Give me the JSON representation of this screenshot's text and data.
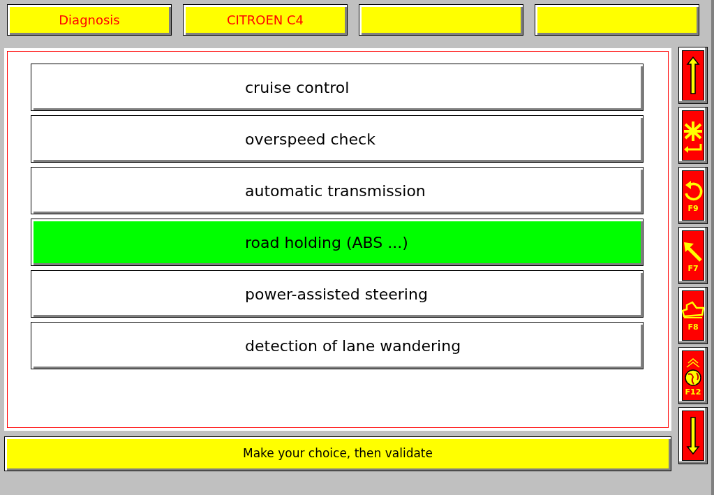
{
  "header": [
    "Diagnosis",
    "CITROEN C4"
  ],
  "menu": [
    {
      "label": "cruise control",
      "selected": false
    },
    {
      "label": "overspeed check",
      "selected": false
    },
    {
      "label": "automatic transmission",
      "selected": false
    },
    {
      "label": "road holding (ABS ...)",
      "selected": true
    },
    {
      "label": "power-assisted steering",
      "selected": false
    },
    {
      "label": "detection of lane wandering",
      "selected": false
    }
  ],
  "status": "Make your choice, then validate",
  "side_buttons": [
    {
      "kind": "up"
    },
    {
      "kind": "escape"
    },
    {
      "kind": "undo",
      "key": "F9"
    },
    {
      "kind": "back",
      "key": "F7"
    },
    {
      "kind": "car",
      "key": "F8"
    },
    {
      "kind": "emblem",
      "key": "F12"
    },
    {
      "kind": "down"
    }
  ]
}
